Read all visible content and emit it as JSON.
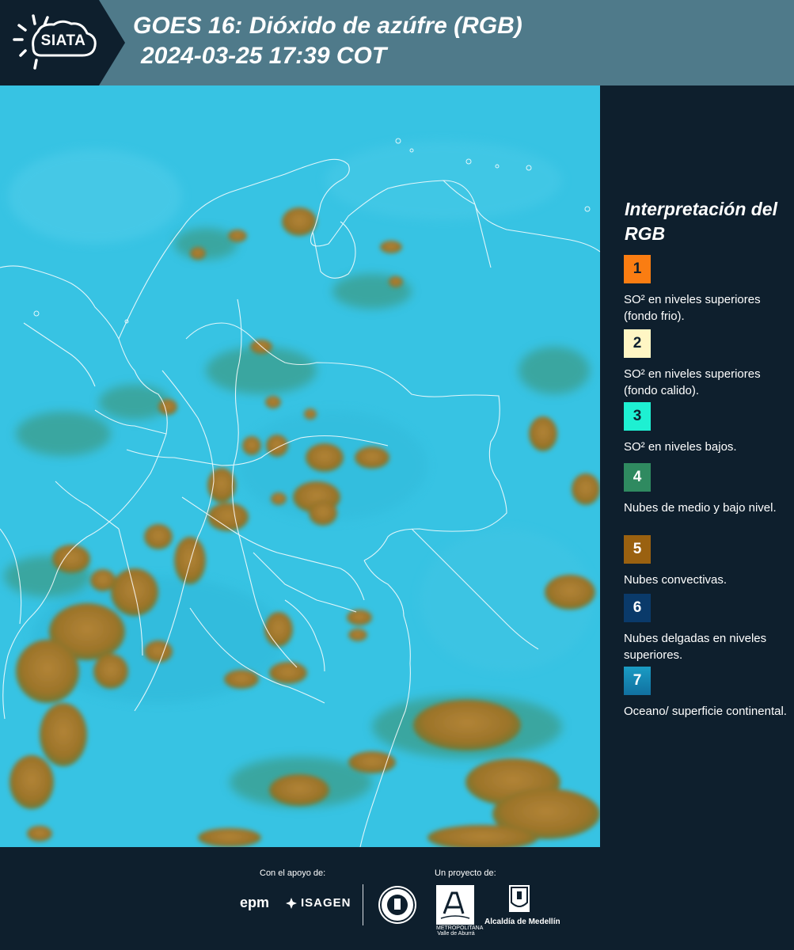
{
  "header": {
    "logo_text": "SIATA",
    "title_line1": "GOES 16: Dióxido de azúfre (RGB)",
    "title_line2": "2024-03-25 17:39 COT"
  },
  "legend": {
    "title": "Interpretación del RGB",
    "items": [
      {
        "number": "1",
        "color": "#fa7d12",
        "text": "SO² en niveles superiores (fondo frio)."
      },
      {
        "number": "2",
        "color": "#fff6c4",
        "text": "SO² en niveles superiores (fondo calido)."
      },
      {
        "number": "3",
        "color": "#1ef0d2",
        "text": "SO² en niveles bajos."
      },
      {
        "number": "4",
        "color": "#2f8a60",
        "text": "Nubes de medio y bajo nivel."
      },
      {
        "number": "5",
        "color": "#9a6110",
        "text": "Nubes convectivas."
      },
      {
        "number": "6",
        "color": "#0a3a6a",
        "text": "Nubes delgadas en niveles superiores."
      },
      {
        "number": "7",
        "color": "#1d8ab0",
        "text": "Oceano/ superficie continental."
      }
    ]
  },
  "footer": {
    "support_label": "Con el apoyo de:",
    "project_label": "Un proyecto de:",
    "epm_logo": "epm",
    "isagen_logo": "ISAGEN",
    "area_logo_text": "METROPOLITANA Valle de Aburrá",
    "alcaldia_logo_text": "Alcaldía de Medellín"
  },
  "colors": {
    "header_bg": "#4f7a8a",
    "panel_bg": "#0e1f2d",
    "map_background": "#37c3e3",
    "convective_cloud": "#a37a2c",
    "mid_low_cloud": "#2f8a60",
    "borders": "#ffffff"
  }
}
